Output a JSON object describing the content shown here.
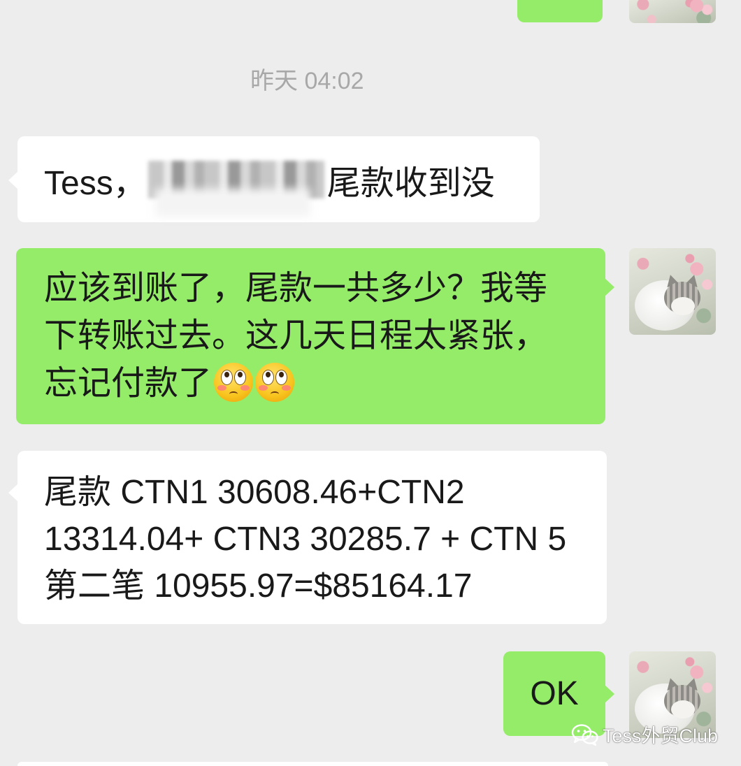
{
  "colors": {
    "background": "#ededed",
    "incoming_bubble": "#ffffff",
    "outgoing_bubble": "#95ec69",
    "text": "#191919",
    "timestamp": "#a8a8a8"
  },
  "chat": {
    "timestamp": "昨天 04:02",
    "messages": [
      {
        "outgoing": false,
        "prefix": "Tess，",
        "redacted": true,
        "suffix": "尾款收到没"
      },
      {
        "outgoing": true,
        "lines": [
          "应该到账了，尾款一共多少？我等",
          "下转账过去。这几天日程太紧张，",
          "忘记付款了"
        ],
        "emojis": [
          "flushed-face-icon",
          "flushed-face-icon"
        ]
      },
      {
        "outgoing": false,
        "lines": [
          "尾款 CTN1 30608.46+CTN2",
          "13314.04+ CTN3 30285.7 + CTN 5",
          "第二笔 10955.97=$85164.17"
        ]
      },
      {
        "outgoing": true,
        "lines": [
          "OK"
        ]
      }
    ]
  },
  "watermark": {
    "icon": "wechat-logo-icon",
    "text": "Tess外贸Club"
  }
}
